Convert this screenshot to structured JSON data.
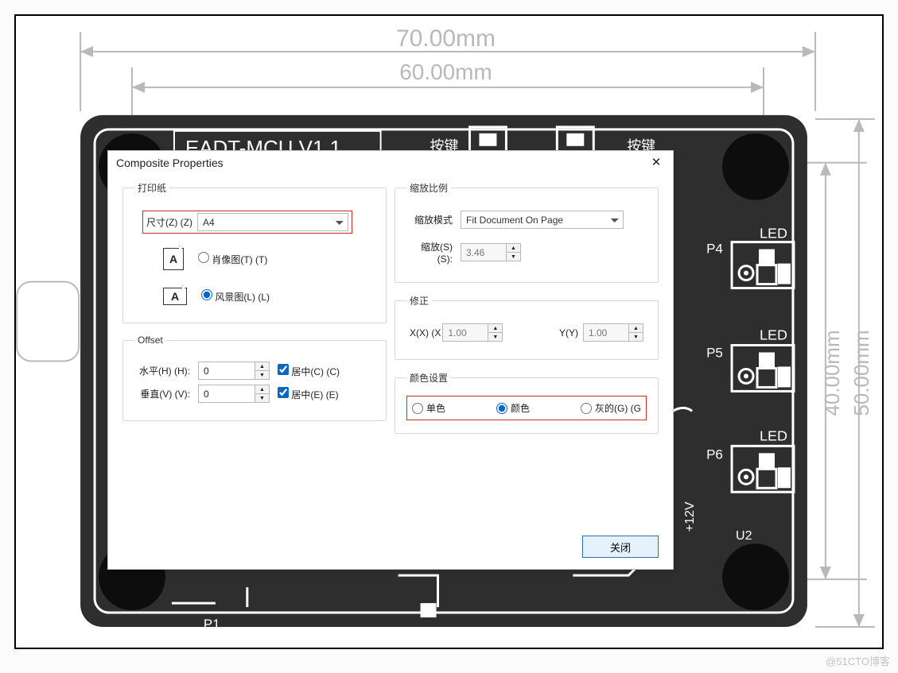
{
  "dialog": {
    "title": "Composite Properties",
    "groups": {
      "paper": {
        "legend": "打印纸",
        "size_label": "尺寸(Z) (Z)",
        "size_value": "A4",
        "portrait_label": "肖像图(T) (T)",
        "landscape_label": "风景图(L) (L)"
      },
      "scale": {
        "legend": "缩放比例",
        "mode_label": "缩放模式",
        "mode_value": "Fit Document On Page",
        "scale_label": "缩放(S) (S):",
        "scale_value": "3.46"
      },
      "correction": {
        "legend": "修正",
        "x_label": "X(X) (X",
        "x_value": "1.00",
        "y_label": "Y(Y)",
        "y_value": "1.00"
      },
      "offset": {
        "legend": "Offset",
        "h_label": "水平(H) (H):",
        "h_value": "0",
        "h_center": "居中(C) (C)",
        "v_label": "垂直(V) (V):",
        "v_value": "0",
        "v_center": "居中(E) (E)"
      },
      "color": {
        "legend": "颜色设置",
        "mono": "单色",
        "color": "颜色",
        "gray": "灰的(G) (G"
      }
    },
    "close_button": "关闭"
  },
  "background": {
    "dim_outer_w": "70.00mm",
    "dim_inner_w": "60.00mm",
    "dim_outer_h": "50.00mm",
    "dim_inner_h": "40.00mm",
    "board_name": "EADT-MCU  V1.1",
    "btn_label_l": "按键",
    "btn_label_r": "按键",
    "led": "LED",
    "p1": "P1",
    "p4": "P4",
    "p5": "P5",
    "p6": "P6",
    "v12": "+12V",
    "u2": "U2"
  },
  "watermark": "@51CTO博客"
}
